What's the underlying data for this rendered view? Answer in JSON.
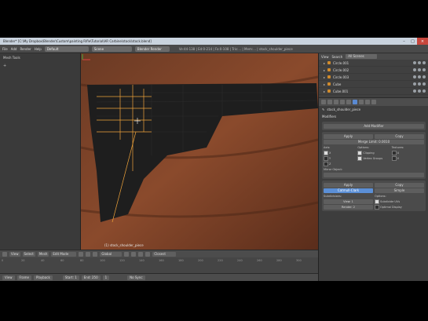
{
  "titlebar": {
    "title": "Blender* [C:\\My Dropbox\\Blender\\Custom\\painting Rifle\\Tutorial\\AR Carbine\\stock\\stock.blend]"
  },
  "topmenu": {
    "items": [
      "File",
      "Add",
      "Render",
      "Help"
    ],
    "layout": "Default",
    "scene": "Scene",
    "engine": "Blender Render",
    "stats": "Ve:44-138 | Ed:0-214 | Fa:0-108 | Tris:... | Mem:... | stock_shoulder_piece"
  },
  "left": {
    "header": "Mesh Tools"
  },
  "viewport": {
    "object_label": "(1) stock_shoulder_piece"
  },
  "vheader": {
    "view": "View",
    "select": "Select",
    "mesh": "Mesh",
    "mode": "Edit Mode",
    "pivot": "Global",
    "snap": "Closest"
  },
  "timeline": {
    "ticks": [
      "0",
      "20",
      "40",
      "60",
      "80",
      "100",
      "120",
      "140",
      "160",
      "180",
      "200",
      "220",
      "240",
      "260",
      "280",
      "300"
    ]
  },
  "playbar": {
    "view": "View",
    "frame": "Frame",
    "playback": "Playback",
    "start": "Start: 1",
    "end": "End: 250",
    "current": "1",
    "sync": "No Sync"
  },
  "outliner": {
    "view": "View",
    "search": "Search",
    "filter": "All Scenes",
    "rows": [
      "Circle.001",
      "Circle.002",
      "Circle.003",
      "Cube",
      "Cube.001"
    ]
  },
  "properties": {
    "object": "stock_shoulder_piece",
    "modifiers_header": "Modifiers",
    "add_modifier": "Add Modifier",
    "apply": "Apply",
    "copy": "Copy",
    "merge_label": "Merge Limit: 0.0010",
    "axis_label": "Axis:",
    "options_label": "Options:",
    "texture_label": "Textures:",
    "clipping": "Clipping",
    "vertex_groups": "Vertex Groups",
    "mirror_object": "Mirror Object:",
    "catmull": "Catmull-Clark",
    "simple": "Simple",
    "subdivisions": "Subdivisions:",
    "view_val": "View: 1",
    "render_val": "Render: 2",
    "options2": "Options:",
    "subdivide_uvs": "Subdivide UVs",
    "optimal_display": "Optimal Display"
  }
}
